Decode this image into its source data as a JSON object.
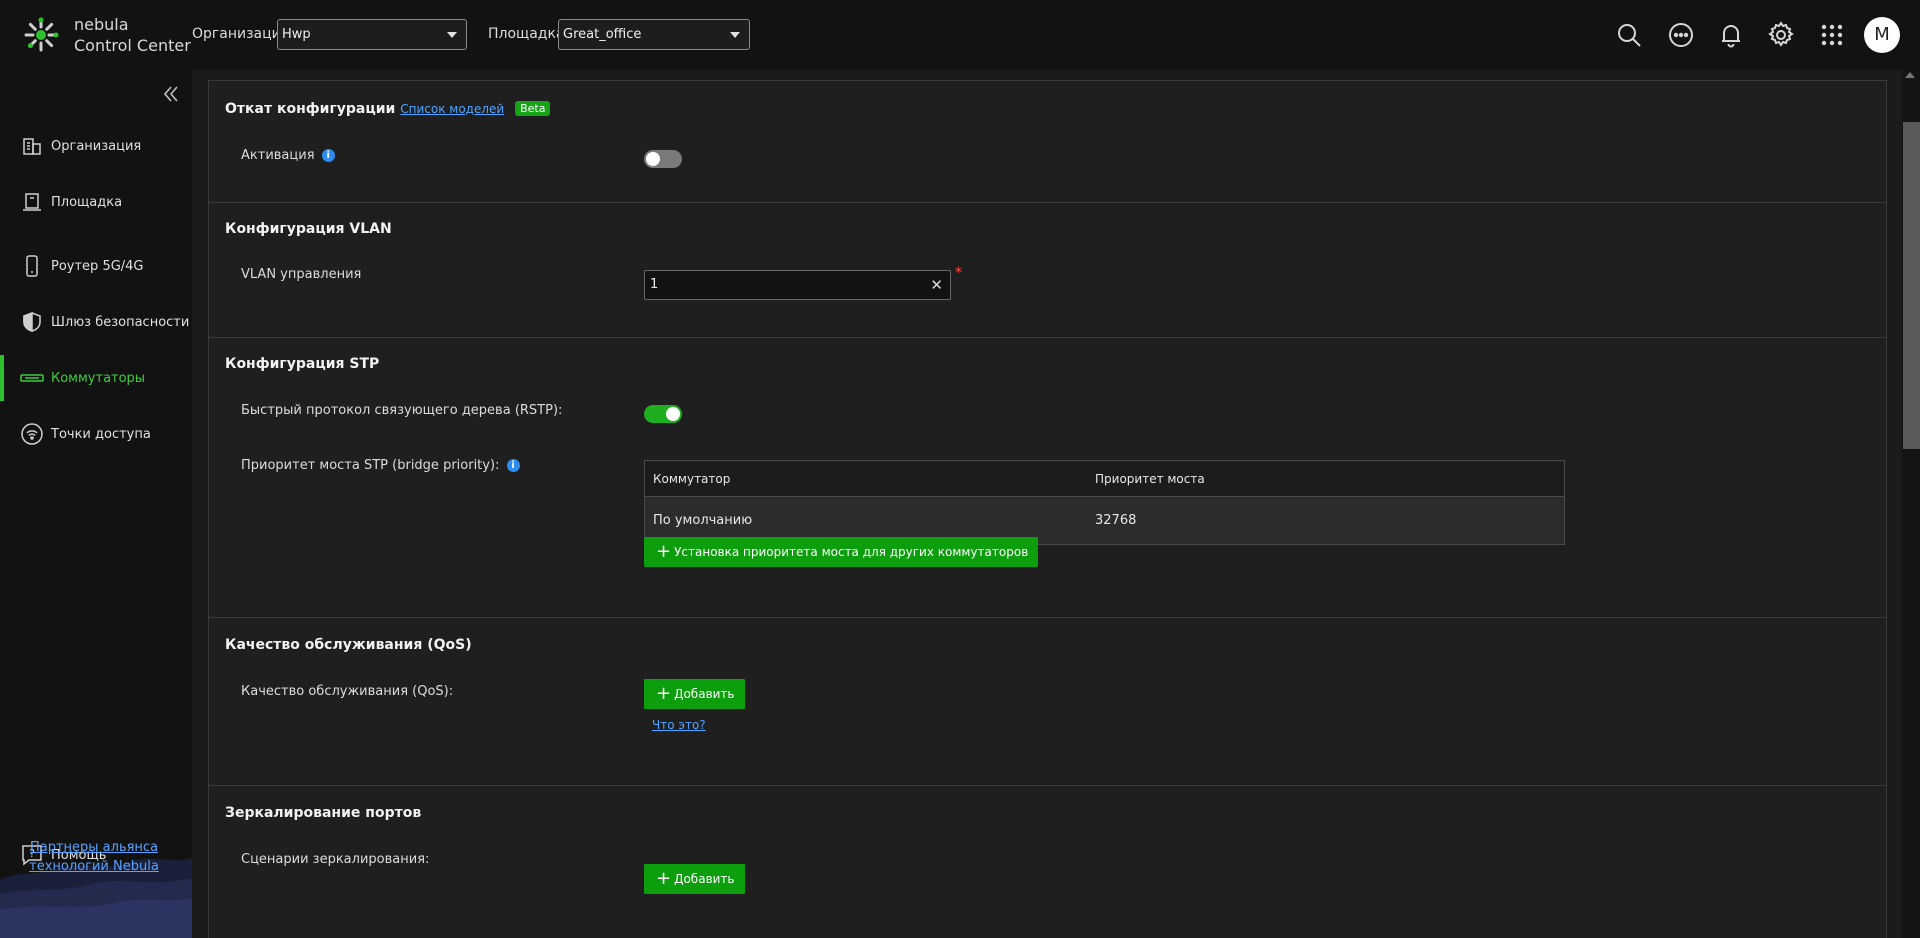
{
  "brand": {
    "line1": "nebula",
    "line2": "Control Center"
  },
  "header": {
    "org_label": "Организация:",
    "org_value": "Hwp",
    "site_label": "Площадка:",
    "site_value": "Great_office",
    "icons": [
      "search-icon",
      "more-icon",
      "bell-icon",
      "gear-icon",
      "apps-grid-icon"
    ],
    "avatar_letter": "M"
  },
  "sidebar": {
    "items": [
      {
        "label": "Организация",
        "icon": "building-icon"
      },
      {
        "label": "Площадка",
        "icon": "site-icon"
      },
      {
        "label": "Роутер 5G/4G",
        "icon": "router-icon"
      },
      {
        "label": "Шлюз безопасности",
        "icon": "shield-icon"
      },
      {
        "label": "Коммутаторы",
        "icon": "switch-icon",
        "active": true
      },
      {
        "label": "Точки доступа",
        "icon": "access-point-icon"
      }
    ],
    "help_label": "Помощь",
    "partners_link": "Партнеры альянса технологий Nebula"
  },
  "sections": {
    "rollback": {
      "title": "Откат конфигурации",
      "models_link": "Список моделей",
      "badge": "Beta",
      "activation_label": "Активация",
      "activation_on": false
    },
    "vlan": {
      "title": "Конфигурация VLAN",
      "mgmt_label": "VLAN управления",
      "mgmt_value": "1",
      "required_mark": "*"
    },
    "stp": {
      "title": "Конфигурация STP",
      "rstp_label": "Быстрый протокол связующего дерева (RSTP):",
      "rstp_on": true,
      "priority_label": "Приоритет моста STP (bridge priority):",
      "table": {
        "headers": [
          "Коммутатор",
          "Приоритет моста"
        ],
        "rows": [
          [
            "По умолчанию",
            "32768"
          ]
        ]
      },
      "add_button": "Установка приоритета моста для других коммутаторов"
    },
    "qos": {
      "title": "Качество обслуживания (QoS)",
      "label": "Качество обслуживания (QoS):",
      "add_button": "Добавить",
      "whatis_link": "Что это?"
    },
    "mirror": {
      "title": "Зеркалирование портов",
      "label": "Сценарии зеркалирования:",
      "add_button": "Добавить"
    }
  },
  "colors": {
    "accent": "#0d9e0d",
    "link": "#4da3ff",
    "info": "#2d8cf0"
  }
}
